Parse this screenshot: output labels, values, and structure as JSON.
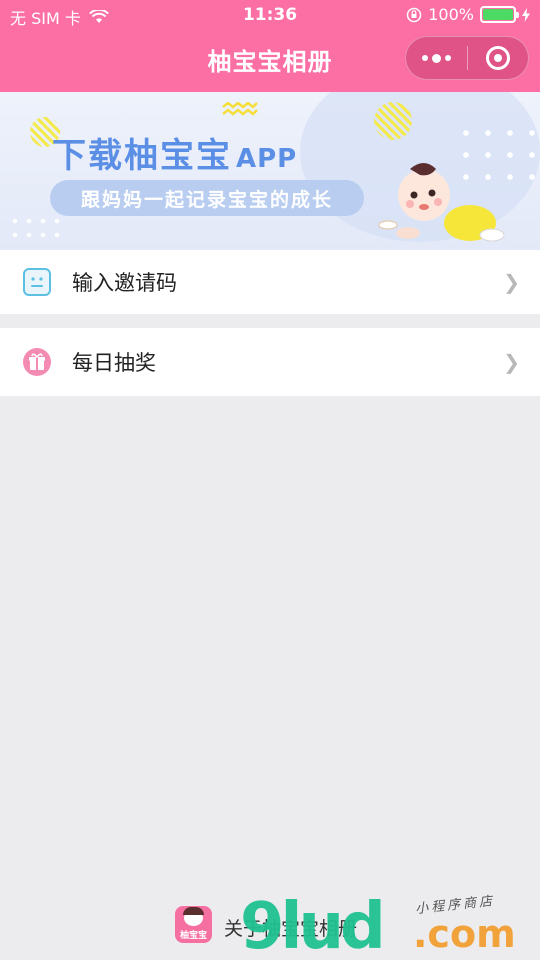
{
  "status_bar": {
    "carrier": "无 SIM 卡",
    "time": "11:36",
    "battery_percent": "100%",
    "wifi_icon": "wifi-icon",
    "lock_icon": "orientation-lock-icon",
    "charging_icon": "charging-icon"
  },
  "nav": {
    "title": "柚宝宝相册",
    "more_icon": "more-dots-icon",
    "close_icon": "target-close-icon"
  },
  "banner": {
    "title_main": "下载柚宝宝",
    "title_app": "APP",
    "subtitle": "跟妈妈一起记录宝宝的成长"
  },
  "menu": {
    "invite": {
      "label": "输入邀请码",
      "icon": "invite-face-icon"
    },
    "lottery": {
      "label": "每日抽奖",
      "icon": "gift-icon"
    }
  },
  "footer": {
    "logo_text": "柚宝宝",
    "about_label": "关于柚宝宝相册"
  },
  "watermark": {
    "brand": "9lud",
    "domain": ".com",
    "tagline": "小程序商店"
  },
  "colors": {
    "header": "#fb6fa4",
    "banner_title": "#5b8fe6",
    "background": "#ececee"
  }
}
